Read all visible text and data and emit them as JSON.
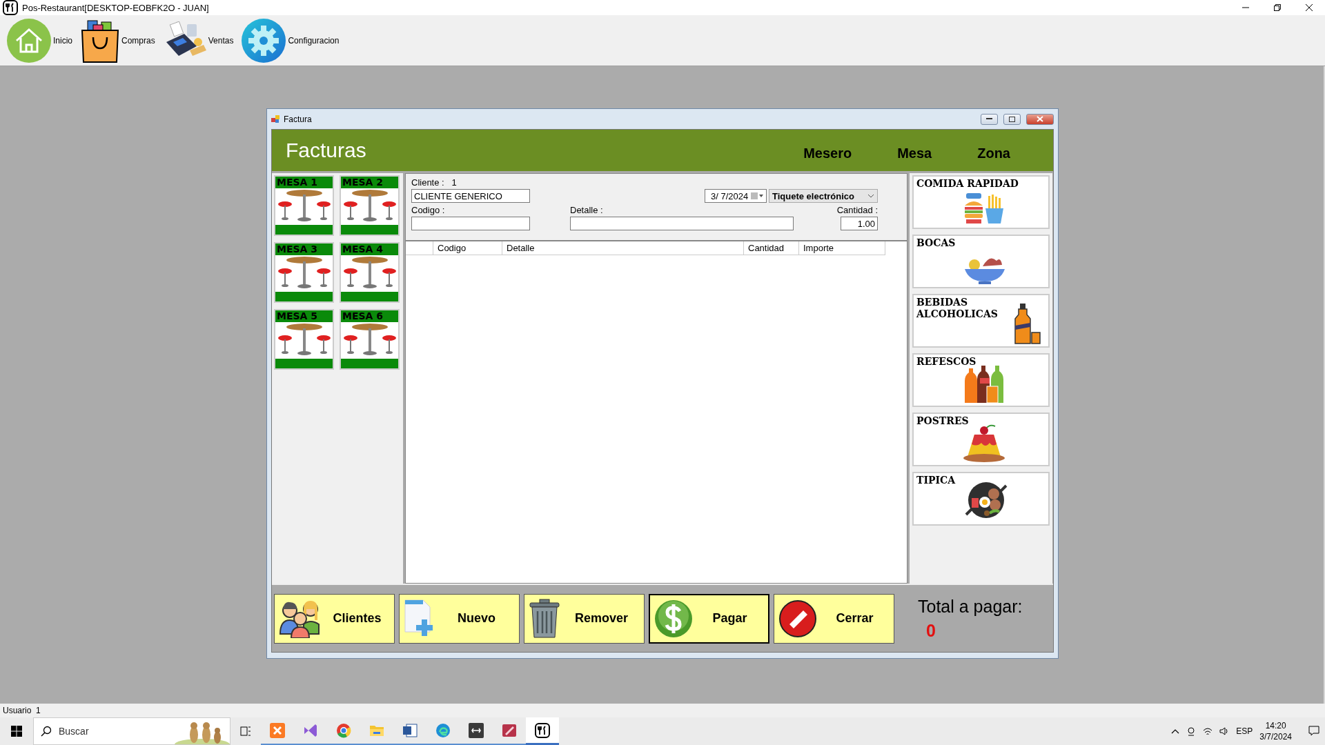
{
  "app": {
    "title": "Pos-Restaurant[DESKTOP-EOBFK2O - JUAN]"
  },
  "toolbar": [
    {
      "label": "Inicio",
      "kind": "home"
    },
    {
      "label": "Compras",
      "kind": "bag"
    },
    {
      "label": "Ventas",
      "kind": "terminal"
    },
    {
      "label": "Configuracion",
      "kind": "gear"
    }
  ],
  "window": {
    "title": "Factura",
    "heading": "Facturas",
    "header_labels": [
      "Mesero",
      "Mesa",
      "Zona"
    ],
    "tables": [
      {
        "label": "MESA 1"
      },
      {
        "label": "MESA 2"
      },
      {
        "label": "MESA 3"
      },
      {
        "label": "MESA 4"
      },
      {
        "label": "MESA 5"
      },
      {
        "label": "MESA 6"
      }
    ],
    "form": {
      "cliente_label": "Cliente :",
      "cliente_id": "1",
      "cliente_name": "CLIENTE GENERICO",
      "date": "3/  7/2024",
      "doc_type": "Tiquete electrónico",
      "codigo_label": "Codigo :",
      "detalle_label": "Detalle :",
      "cantidad_label": "Cantidad :",
      "cantidad": "1.00"
    },
    "grid": {
      "columns": [
        "Codigo",
        "Detalle",
        "Cantidad",
        "Importe"
      ]
    },
    "categories": [
      {
        "label": "COMIDA RAPIDAD",
        "kind": "fastfood"
      },
      {
        "label": "BOCAS",
        "kind": "bowl"
      },
      {
        "label": "BEBIDAS ALCOHOLICAS",
        "kind": "liquor"
      },
      {
        "label": "REFESCOS",
        "kind": "soda"
      },
      {
        "label": "POSTRES",
        "kind": "flan"
      },
      {
        "label": "TIPICA",
        "kind": "pan"
      }
    ],
    "buttons": [
      {
        "label": "Clientes",
        "kind": "clients",
        "focused": false
      },
      {
        "label": "Nuevo",
        "kind": "new",
        "focused": false
      },
      {
        "label": "Remover",
        "kind": "trash",
        "focused": false
      },
      {
        "label": "Pagar",
        "kind": "pay",
        "focused": true
      },
      {
        "label": "Cerrar",
        "kind": "close",
        "focused": false
      }
    ],
    "total_label": "Total a pagar:",
    "total": "0"
  },
  "status_bar": {
    "user_label": "Usuario",
    "user": "1"
  },
  "taskbar": {
    "search_placeholder": "Buscar",
    "apps": [
      {
        "kind": "xampp",
        "selected": false
      },
      {
        "kind": "vs",
        "selected": false
      },
      {
        "kind": "chrome",
        "selected": false
      },
      {
        "kind": "folder",
        "selected": false
      },
      {
        "kind": "word",
        "selected": false
      },
      {
        "kind": "edge",
        "selected": false
      },
      {
        "kind": "dark",
        "selected": false
      },
      {
        "kind": "pink",
        "selected": false
      },
      {
        "kind": "pos",
        "selected": true
      }
    ],
    "language": "ESP",
    "time": "14:20",
    "date": "3/7/2024"
  }
}
